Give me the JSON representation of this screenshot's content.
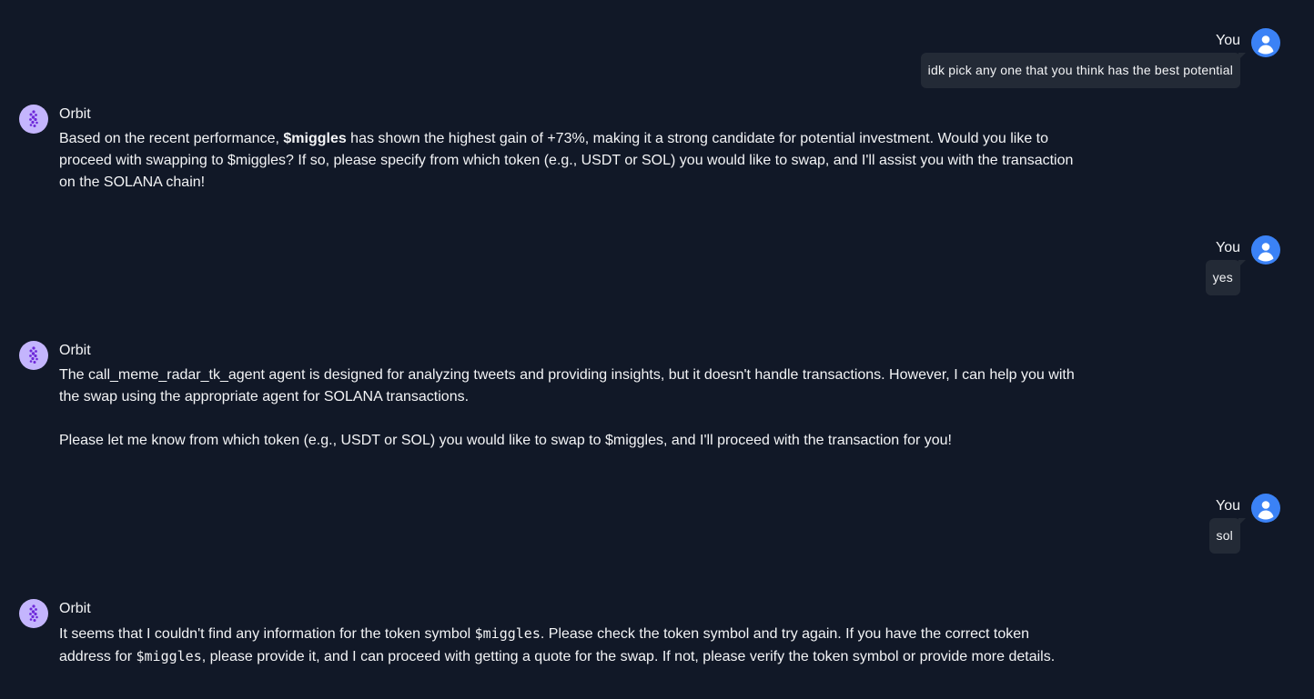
{
  "user_label": "You",
  "bot_label": "Orbit",
  "messages": {
    "m1": {
      "text": "idk pick any one that you think has the best potential"
    },
    "m2": {
      "p1_a": "Based on the recent performance, ",
      "p1_b": "$miggles",
      "p1_c": " has shown the highest gain of +73%, making it a strong candidate for potential investment. Would you like to proceed with swapping to $miggles? If so, please specify from which token (e.g., USDT or SOL) you would like to swap, and I'll assist you with the transaction on the SOLANA chain!"
    },
    "m3": {
      "text": "yes"
    },
    "m4": {
      "p1": "The call_meme_radar_tk_agent agent is designed for analyzing tweets and providing insights, but it doesn't handle transactions. However, I can help you with the swap using the appropriate agent for SOLANA transactions.",
      "p2": "Please let me know from which token (e.g., USDT or SOL) you would like to swap to $miggles, and I'll proceed with the transaction for you!"
    },
    "m5": {
      "text": "sol"
    },
    "m6": {
      "a": "It seems that I couldn't find any information for the token symbol ",
      "b": "$miggles",
      "c": ". Please check the token symbol and try again. If you have the correct token address for ",
      "d": "$miggles",
      "e": ", please provide it, and I can proceed with getting a quote for the swap. If not, please verify the token symbol or provide more details."
    }
  },
  "colors": {
    "background": "#111827",
    "user_avatar": "#3b82f6",
    "bot_avatar": "#c4b5fd",
    "bubble": "#232a36"
  },
  "icons": {
    "user_avatar": "user-avatar-icon",
    "bot_avatar": "orbit-bot-avatar-icon"
  }
}
